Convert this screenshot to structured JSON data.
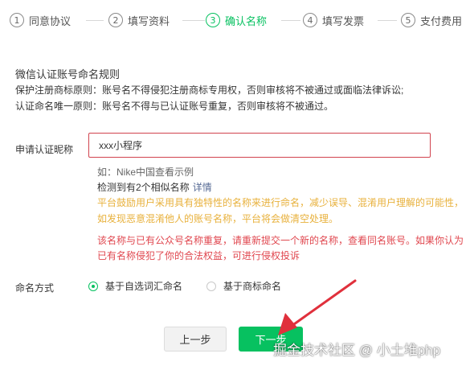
{
  "steps": [
    {
      "num": "1",
      "label": "同意协议"
    },
    {
      "num": "2",
      "label": "填写资料"
    },
    {
      "num": "3",
      "label": "确认名称"
    },
    {
      "num": "4",
      "label": "填写发票"
    },
    {
      "num": "5",
      "label": "支付费用"
    }
  ],
  "active_step_index": 2,
  "rules": {
    "title": "微信认证账号命名规则",
    "rule1": "保护注册商标原则：账号名不得侵犯注册商标专用权，否则审核将不被通过或面临法律诉讼;",
    "rule2": "认证命名唯一原则：账号名不得与已认证账号重复，否则审核将不被通过。"
  },
  "form": {
    "name_label": "申请认证昵称",
    "name_value": "xxx小程序",
    "example_hint": "如：Nike中国查看示例",
    "similar_hint": "检测到有2个相似名称",
    "similar_detail": "详情",
    "warning_yellow_1": "平台鼓励用户采用具有独特性的名称来进行命名，减少误导、混淆用户理解的可能性，",
    "warning_yellow_2": "如发现恶意混淆他人的账号名称，平台将会做清空处理。",
    "warning_red_1": "该名称与已有公众号名称重复，请重新提交一个新的名称，查看同名账号。如果你认为",
    "warning_red_2": "已有名称侵犯了你的合法权益，可进行侵权投诉",
    "method_label": "命名方式",
    "method_option_a": "基于自选词汇命名",
    "method_option_b": "基于商标命名",
    "method_selected": "基于自选词汇命名"
  },
  "buttons": {
    "prev": "上一步",
    "next": "下一步"
  },
  "watermark": "掘金技术社区 @ 小土堆php",
  "colors": {
    "accent_green": "#07c160",
    "warning_yellow": "#e8b13c",
    "warning_red": "#e0474f",
    "input_error_border": "#d1434e",
    "arrow_red": "#e0303c",
    "link_blue": "#576b95"
  }
}
